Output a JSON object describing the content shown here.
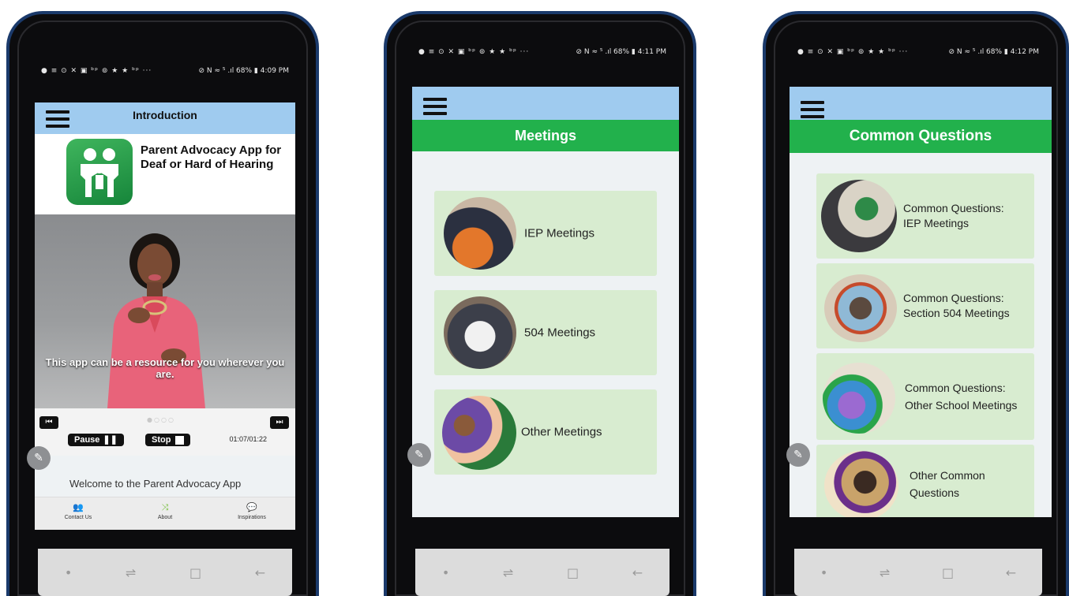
{
  "phones": [
    {
      "status": {
        "icons": "● ≡ ⊙ ✕ ▣ ᵇᵖ ⊚ ★ ★ ᵇᵖ ···",
        "right": "⊘ N ≈ ⁵ .ıl 68% ▮ 4:09 PM"
      },
      "header_title": "Introduction",
      "app_name": "Parent Advocacy App for Deaf or Hard of Hearing",
      "video_caption": "This app can be a resource for you wherever you are.",
      "controls": {
        "pause": "Pause",
        "stop": "Stop",
        "timer": "01:07/01:22",
        "dots": "●○○○"
      },
      "welcome_text": "Welcome to the Parent Advocacy App",
      "bottom_nav": [
        {
          "label": "Contact Us",
          "icon": "👥"
        },
        {
          "label": "About",
          "icon": "⤨"
        },
        {
          "label": "Inspirations",
          "icon": "💬"
        }
      ]
    },
    {
      "status": {
        "icons": "● ≡ ⊙ ✕ ▣ ᵇᵖ ⊚ ★ ★ ᵇᵖ ···",
        "right": "⊘ N ≈ ⁵ .ıl 68% ▮ 4:11 PM"
      },
      "title": "Meetings",
      "items": [
        "IEP Meetings",
        "504 Meetings",
        "Other Meetings"
      ]
    },
    {
      "status": {
        "icons": "● ≡ ⊙ ✕ ▣ ᵇᵖ ⊚ ★ ★ ᵇᵖ ···",
        "right": "⊘ N ≈ ⁵ .ıl 68% ▮ 4:12 PM"
      },
      "title": "Common Questions",
      "items": [
        "Common Questions: IEP Meetings",
        "Common Questions: Section 504 Meetings",
        "Common Questions: Other School Meetings",
        "Other Common Questions"
      ]
    }
  ],
  "android_nav": {
    "dot": "•",
    "recent": "⇌",
    "home": "□",
    "back": "←"
  },
  "colors": {
    "frame": "#1b3a6b",
    "title_green": "#22b14c",
    "top_blue": "#9fcbef",
    "card_green": "#d8ecd0"
  }
}
